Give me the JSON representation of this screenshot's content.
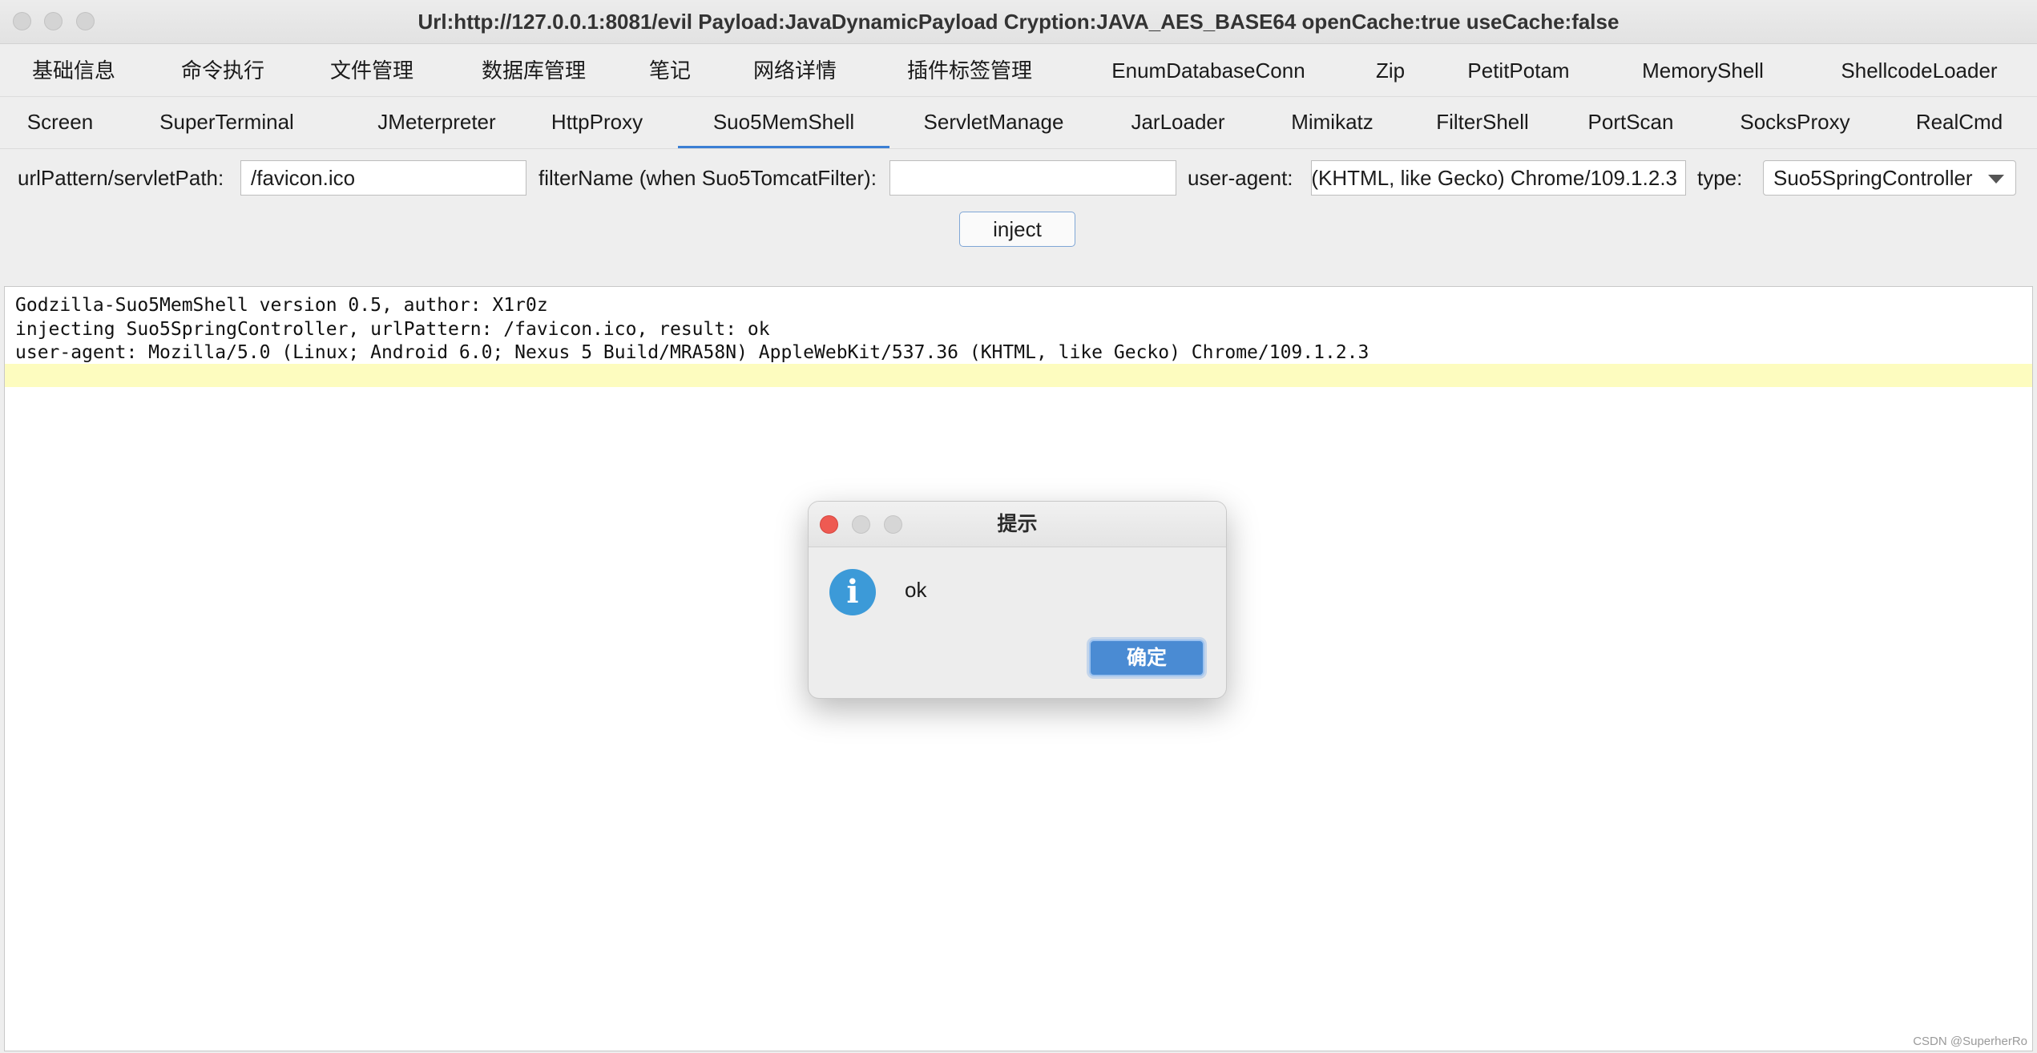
{
  "window": {
    "title": "Url:http://127.0.0.1:8081/evil Payload:JavaDynamicPayload Cryption:JAVA_AES_BASE64 openCache:true useCache:false"
  },
  "tabs_row1": [
    "基础信息",
    "命令执行",
    "文件管理",
    "数据库管理",
    "笔记",
    "网络详情",
    "插件标签管理",
    "EnumDatabaseConn",
    "Zip",
    "PetitPotam",
    "MemoryShell",
    "ShellcodeLoader"
  ],
  "tabs_row2": [
    "Screen",
    "SuperTerminal",
    "JMeterpreter",
    "HttpProxy",
    "Suo5MemShell",
    "ServletManage",
    "JarLoader",
    "Mimikatz",
    "FilterShell",
    "PortScan",
    "SocksProxy",
    "RealCmd"
  ],
  "active_tab": "Suo5MemShell",
  "form": {
    "url_label": "urlPattern/servletPath:",
    "url_value": "/favicon.ico",
    "filter_label": "filterName (when Suo5TomcatFilter):",
    "filter_value": "",
    "ua_label": "user-agent:",
    "ua_value": "Mozilla/5.0 (Linux; Android 6.0; Nexus 5 Build/MRA58N) AppleWebKit/537.36 (KHTML, like Gecko) Chrome/109.1.2.3",
    "type_label": "type:",
    "type_value": "Suo5SpringController",
    "inject_label": "inject"
  },
  "output": {
    "lines": [
      "Godzilla-Suo5MemShell version 0.5, author: X1r0z",
      "injecting Suo5SpringController, urlPattern: /favicon.ico, result: ok",
      "user-agent: Mozilla/5.0 (Linux; Android 6.0; Nexus 5 Build/MRA58N) AppleWebKit/537.36 (KHTML, like Gecko) Chrome/109.1.2.3"
    ]
  },
  "dialog": {
    "title": "提示",
    "message": "ok",
    "ok_label": "确定",
    "icon": "info-icon"
  },
  "watermark": "CSDN @SuperherRo",
  "colors": {
    "accent": "#3b7fd4",
    "close_red": "#ee5a52",
    "info_blue": "#3c9ad8",
    "highlight_yellow": "#fdfcbf"
  }
}
